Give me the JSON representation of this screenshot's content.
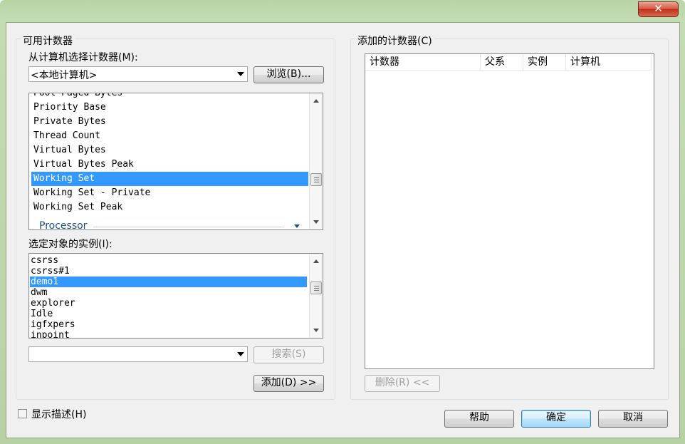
{
  "window": {
    "close_glyph": "✕"
  },
  "available": {
    "group_label": "可用计数器",
    "select_label": "从计算机选择计数器(M):",
    "computer_value": "<本地计算机>",
    "browse_label": "浏览(B)...",
    "counters": [
      "Pool Paged Bytes",
      "Priority Base",
      "Private Bytes",
      "Thread Count",
      "Virtual Bytes",
      "Virtual Bytes Peak",
      "Working Set",
      "Working Set - Private",
      "Working Set Peak"
    ],
    "selected_counter": "Working Set",
    "category": "Processor",
    "instances_label": "选定对象的实例(I):",
    "instances": [
      "csrss",
      "csrss#1",
      "demo1",
      "dwm",
      "explorer",
      "Idle",
      "igfxpers",
      "inpoint"
    ],
    "selected_instance": "demo1",
    "search_value": "",
    "search_label": "搜索(S)",
    "add_label": "添加(D) >>"
  },
  "added": {
    "group_label": "添加的计数器(C)",
    "columns": [
      "计数器",
      "父系",
      "实例",
      "计算机"
    ],
    "remove_label": "删除(R) <<"
  },
  "footer": {
    "show_desc_label": "显示描述(H)",
    "show_desc_checked": false,
    "help_label": "帮助",
    "ok_label": "确定",
    "cancel_label": "取消"
  },
  "colors": {
    "selection": "#3399ff",
    "frame": "#b9d3a5",
    "close": "#c9402a"
  }
}
